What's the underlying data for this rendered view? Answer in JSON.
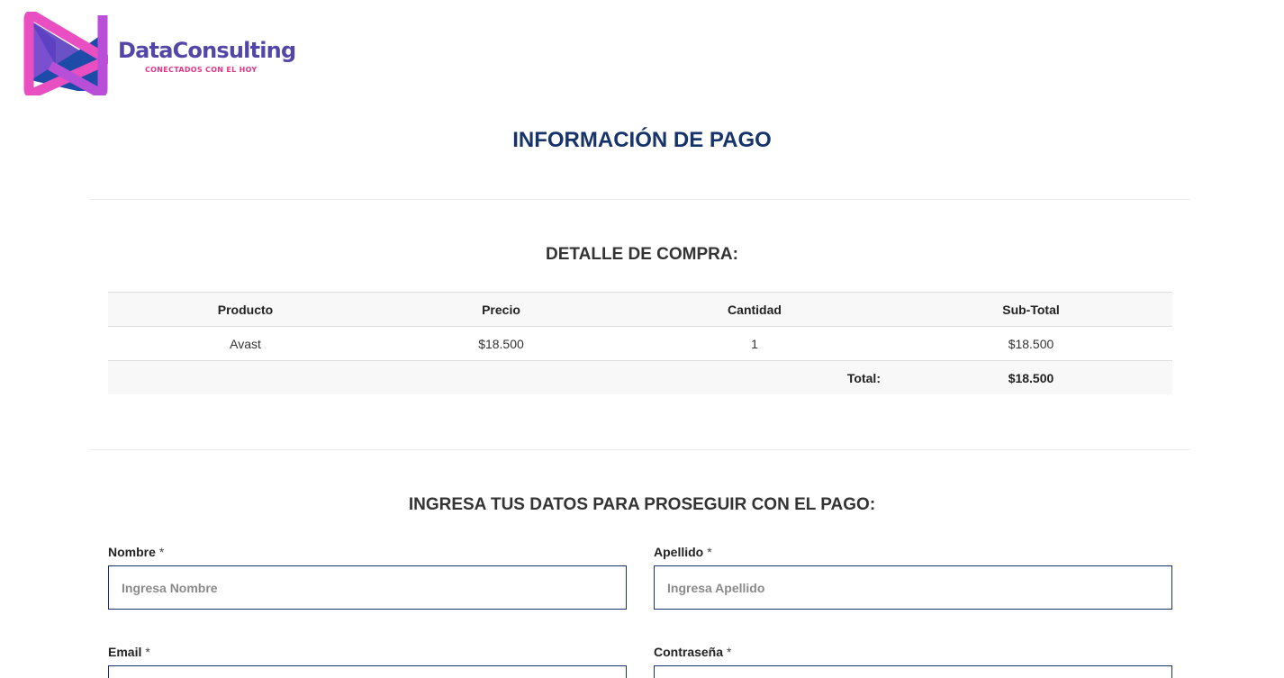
{
  "brand": {
    "name": "DataConsulting",
    "tagline": "CONECTADOS CON EL HOY",
    "colors": {
      "primary": "#5446a8",
      "accent": "#e53585",
      "blue": "#1c4ba8",
      "magenta": "#e94fc0"
    }
  },
  "page": {
    "title": "INFORMACIÓN DE PAGO",
    "title_color": "#17336b"
  },
  "purchase": {
    "heading": "DETALLE DE COMPRA:",
    "columns": [
      "Producto",
      "Precio",
      "Cantidad",
      "Sub-Total"
    ],
    "rows": [
      {
        "product": "Avast",
        "price": "$18.500",
        "quantity": "1",
        "subtotal": "$18.500"
      }
    ],
    "total_label": "Total:",
    "total_value": "$18.500"
  },
  "form": {
    "heading": "INGRESA TUS DATOS PARA PROSEGUIR CON EL PAGO:",
    "required_mark": "*",
    "nombre": {
      "label": "Nombre",
      "placeholder": "Ingresa Nombre",
      "value": ""
    },
    "apellido": {
      "label": "Apellido",
      "placeholder": "Ingresa Apellido",
      "value": ""
    },
    "email": {
      "label": "Email",
      "placeholder": "",
      "value": ""
    },
    "password": {
      "label": "Contraseña",
      "placeholder": "",
      "value": ""
    }
  }
}
